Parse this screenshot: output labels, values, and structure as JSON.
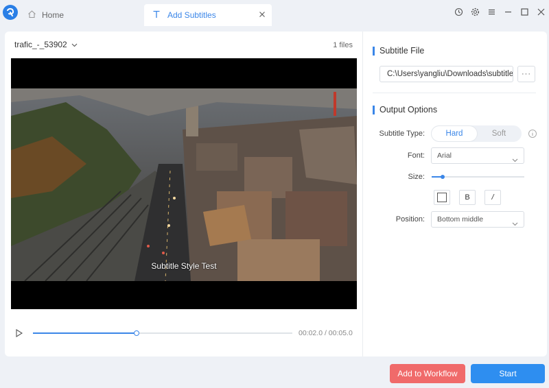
{
  "app": {
    "logo_icon": "app-logo-icon",
    "accent_color": "#3a86e8"
  },
  "tabs": [
    {
      "label": "Home",
      "icon": "home-icon",
      "active": false
    },
    {
      "label": "Add Subtitles",
      "icon": "text-t-icon",
      "active": true
    }
  ],
  "window_controls": [
    "history-icon",
    "settings-icon",
    "menu-icon",
    "minimize-icon",
    "maximize-icon",
    "close-icon"
  ],
  "left_panel": {
    "file_name": "trafic_-_53902",
    "file_count": "1 files",
    "subtitle_preview_text": "Subtitle Style Test",
    "player": {
      "time_display": "00:02.0 / 00:05.0",
      "progress": 0.4
    }
  },
  "right_panel": {
    "subtitle_file": {
      "title": "Subtitle File",
      "path_value": "C:\\Users\\yangliu\\Downloads\\subtitle",
      "browse_label": "···"
    },
    "output_options": {
      "title": "Output Options",
      "subtitle_type_label": "Subtitle Type:",
      "subtitle_type_options": [
        "Hard",
        "Soft"
      ],
      "subtitle_type_selected": "Hard",
      "font_label": "Font:",
      "font_value": "Arial",
      "size_label": "Size:",
      "size_level": 0.12,
      "color_swatch": "#ffffff",
      "bold_label": "B",
      "italic_label": "/",
      "position_label": "Position:",
      "position_value": "Bottom middle"
    }
  },
  "footer": {
    "workflow_label": "Add to Workflow",
    "start_label": "Start",
    "workflow_color": "#f06a6a",
    "start_color": "#2e8ef0"
  }
}
